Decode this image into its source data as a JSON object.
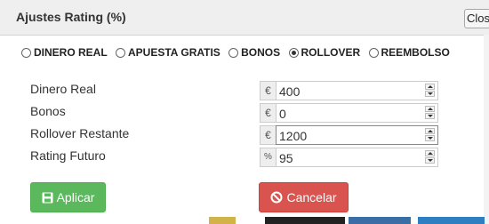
{
  "dialog": {
    "title": "Ajustes Rating (%)",
    "close_label": "Close"
  },
  "radios": [
    {
      "label": "DINERO REAL",
      "checked": false
    },
    {
      "label": "APUESTA GRATIS",
      "checked": false
    },
    {
      "label": "BONOS",
      "checked": false
    },
    {
      "label": "ROLLOVER",
      "checked": true
    },
    {
      "label": "REEMBOLSO",
      "checked": false
    }
  ],
  "fields": [
    {
      "label": "Dinero Real",
      "addon": "€",
      "value": "400"
    },
    {
      "label": "Bonos",
      "addon": "€",
      "value": "0"
    },
    {
      "label": "Rollover Restante",
      "addon": "€",
      "value": "1200"
    },
    {
      "label": "Rating Futuro",
      "addon": "%",
      "value": "95"
    }
  ],
  "buttons": {
    "apply_label": "Aplicar",
    "cancel_label": "Cancelar"
  },
  "colors": {
    "apply": "#5cb85c",
    "cancel": "#d9534f",
    "titlebar": "#efefef"
  },
  "icons": {
    "apply": "floppy-disk-icon",
    "cancel": "ban-icon"
  }
}
